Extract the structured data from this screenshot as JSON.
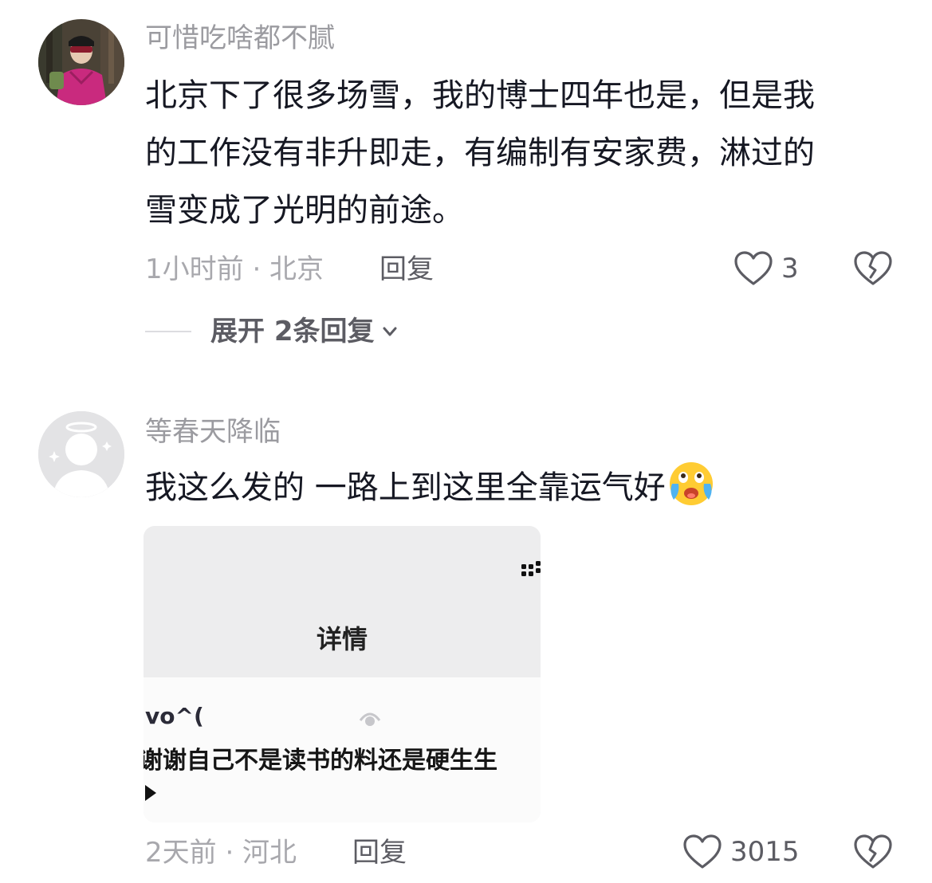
{
  "comments": [
    {
      "username": "可惜吃啥都不腻",
      "avatar_icon": "user-photo-avatar",
      "lines": [
        "北京下了很多场雪，我的博士四年也是，但是我",
        "的工作没有非升即走，有编制有安家费，淋过的",
        "雪变成了光明的前途。"
      ],
      "meta": "1小时前 · 北京",
      "reply_label": "回复",
      "likes": "3",
      "expand_label": "展开 2条回复"
    },
    {
      "username": "等春天降临",
      "avatar_icon": "default-angel-avatar",
      "text": "我这么发的 一路上到这里全靠运气好",
      "emoji": "crying-face-emoji",
      "meta": "2天前 · 河北",
      "reply_label": "回复",
      "likes": "3015",
      "screenshot": {
        "title": "详情",
        "user": "vo^(",
        "text": "谢谢自己不是读书的料还是硬生生"
      }
    }
  ],
  "colors": {
    "like_icon": "#5c5c63",
    "username": "#9b9ba0",
    "text": "#161823"
  }
}
